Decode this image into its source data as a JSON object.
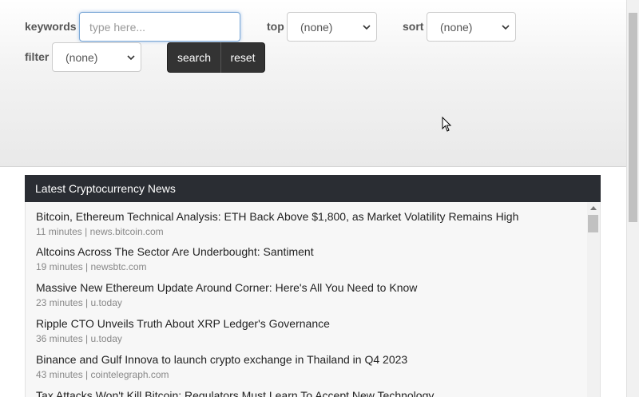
{
  "filters": {
    "keywords_label": "keywords",
    "keywords_placeholder": "type here...",
    "top_label": "top",
    "top_value": "(none)",
    "sort_label": "sort",
    "sort_value": "(none)",
    "filter_label": "filter",
    "filter_value": "(none)",
    "search_label": "search",
    "reset_label": "reset"
  },
  "news": {
    "header": "Latest Cryptocurrency News",
    "items": [
      {
        "title": "Bitcoin, Ethereum Technical Analysis: ETH Back Above $1,800, as Market Volatility Remains High",
        "age": "11 minutes",
        "source": "news.bitcoin.com"
      },
      {
        "title": "Altcoins Across The Sector Are Underbought: Santiment",
        "age": "19 minutes",
        "source": "newsbtc.com"
      },
      {
        "title": "Massive New Ethereum Update Around Corner: Here's All You Need to Know",
        "age": "23 minutes",
        "source": "u.today"
      },
      {
        "title": "Ripple CTO Unveils Truth About XRP Ledger's Governance",
        "age": "36 minutes",
        "source": "u.today"
      },
      {
        "title": "Binance and Gulf Innova to launch crypto exchange in Thailand in Q4 2023",
        "age": "43 minutes",
        "source": "cointelegraph.com"
      },
      {
        "title": "Tax Attacks Won't Kill Bitcoin: Regulators Must Learn To Accept New Technology",
        "age": "",
        "source": ""
      }
    ]
  },
  "icons": {
    "dropdown": "chevron-down-icon",
    "pointer": "mouse-cursor-icon"
  }
}
